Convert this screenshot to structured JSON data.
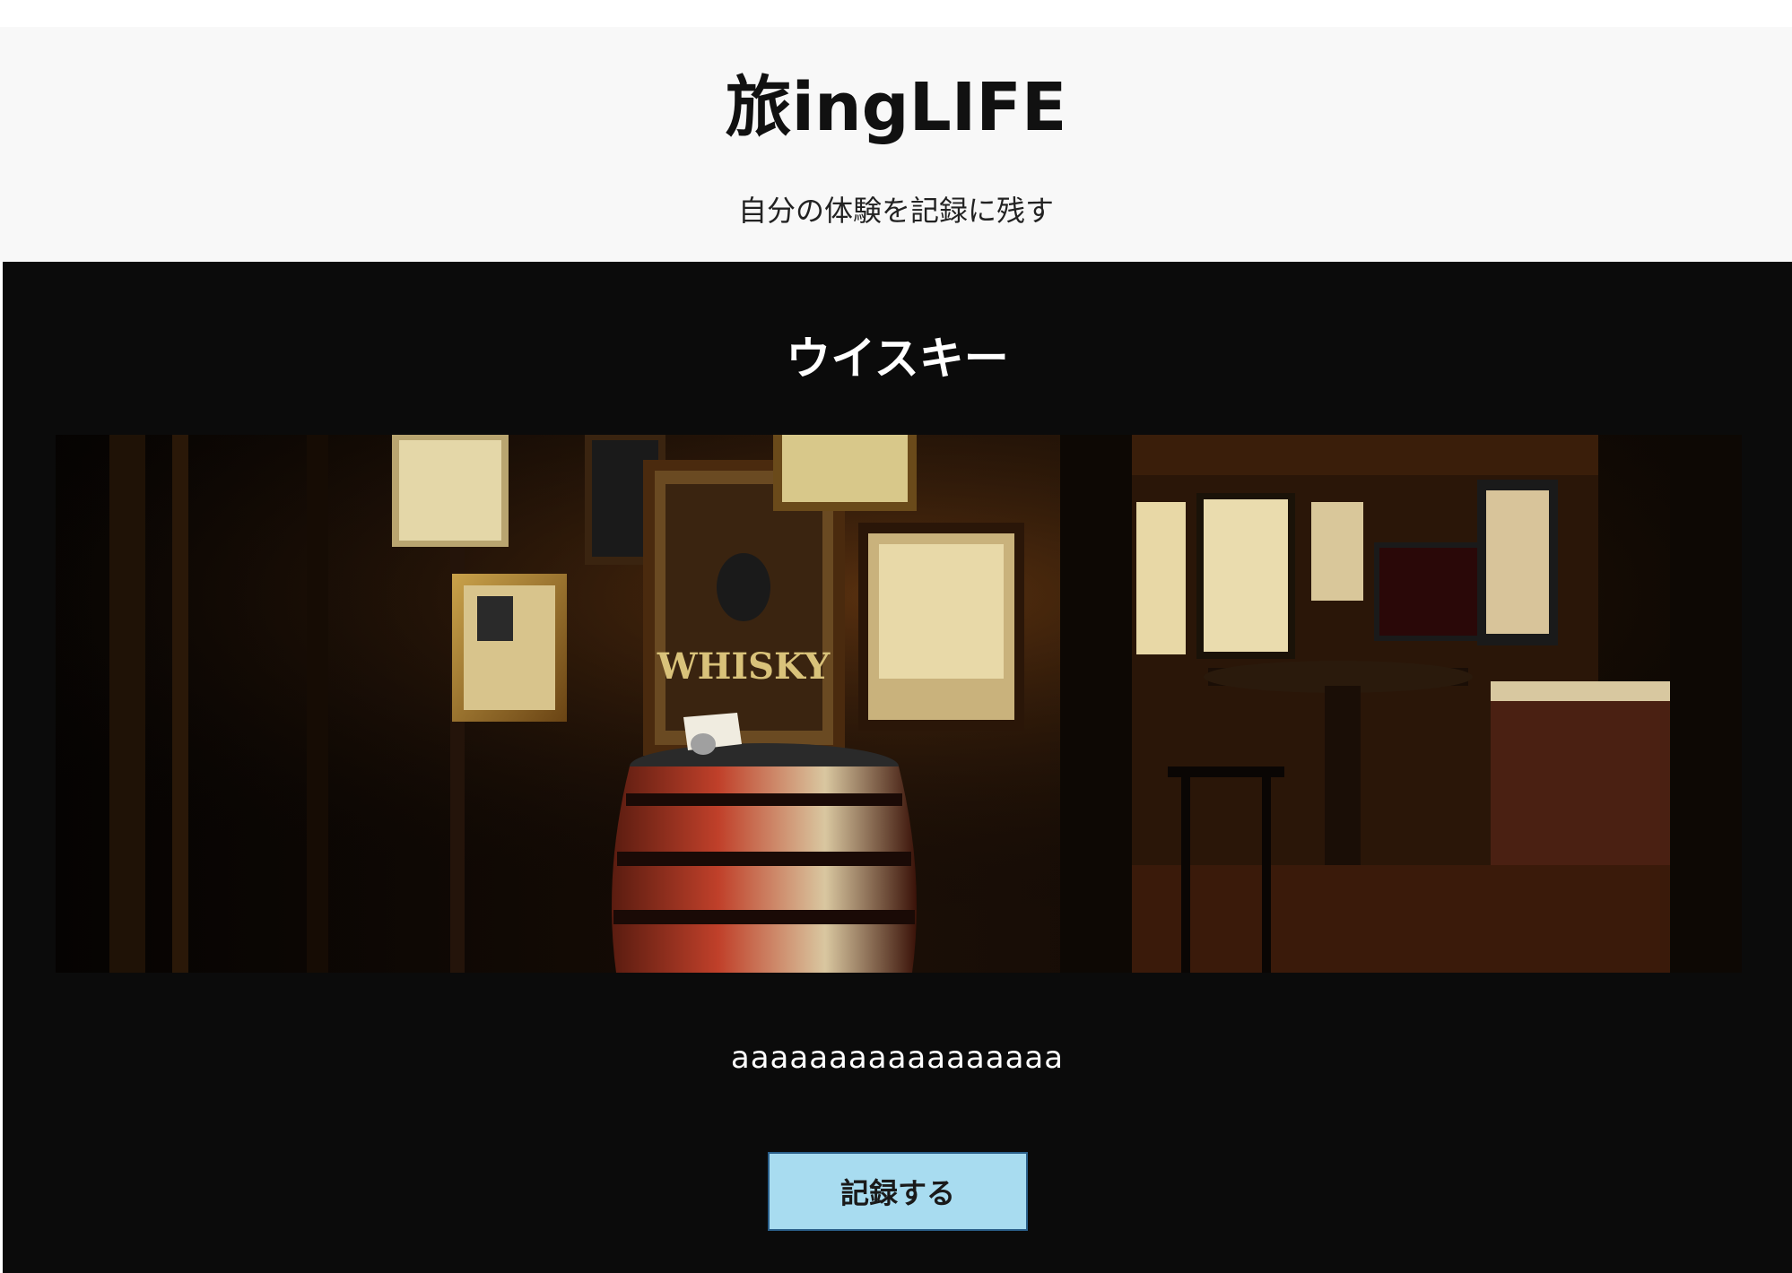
{
  "header": {
    "site_title": "旅ingLIFE",
    "tagline": "自分の体験を記録に残す"
  },
  "post": {
    "title": "ウイスキー",
    "image_sign_text": "WHISKY",
    "description": "aaaaaaaaaaaaaaaaa",
    "record_button_label": "記録する"
  },
  "colors": {
    "header_bg": "#f8f8f8",
    "main_bg": "#0b0b0b",
    "button_bg": "#a8dcf0",
    "button_border": "#2a5f8a"
  }
}
